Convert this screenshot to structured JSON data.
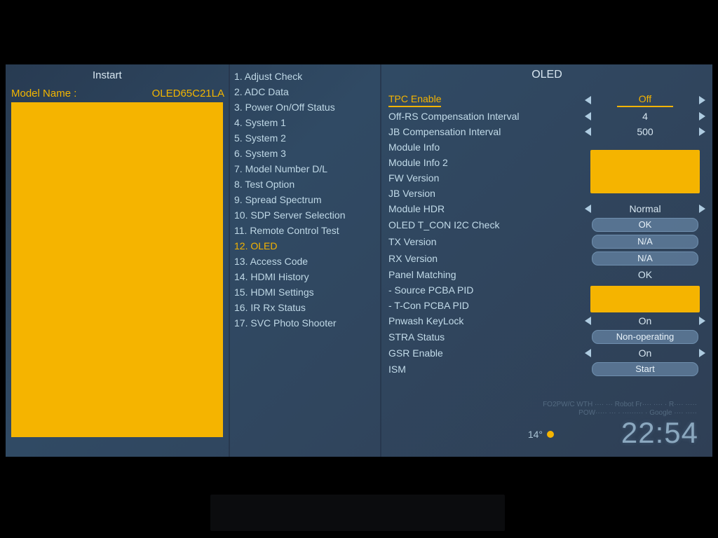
{
  "left": {
    "instart": "Instart",
    "model_label": "Model Name :",
    "model_value": "OLED65C21LA"
  },
  "menu": {
    "items": [
      "1. Adjust Check",
      "2. ADC Data",
      "3. Power On/Off Status",
      "4. System 1",
      "5. System 2",
      "6. System 3",
      "7. Model Number D/L",
      "8. Test Option",
      "9. Spread Spectrum",
      "10. SDP Server Selection",
      "11. Remote Control Test",
      "12. OLED",
      "13. Access Code",
      "14. HDMI History",
      "15. HDMI Settings",
      "16. IR Rx Status",
      "17. SVC Photo Shooter"
    ],
    "selected_index": 11
  },
  "right": {
    "title": "OLED",
    "rows": [
      {
        "label": "TPC Enable",
        "value": "Off",
        "arrows": true,
        "selected": true
      },
      {
        "label": "Off-RS Compensation Interval",
        "value": "4",
        "arrows": true
      },
      {
        "label": "JB Compensation Interval",
        "value": "500",
        "arrows": true
      },
      {
        "label": "Module Info"
      },
      {
        "label": "Module Info 2"
      },
      {
        "label": "FW Version"
      },
      {
        "label": "JB Version"
      },
      {
        "label": "Module HDR",
        "value": "Normal",
        "arrows": true
      },
      {
        "label": "OLED T_CON I2C Check",
        "value": "OK",
        "pill": true
      },
      {
        "label": "TX Version",
        "value": "N/A",
        "pill": true
      },
      {
        "label": "RX Version",
        "value": "N/A",
        "pill": true
      },
      {
        "label": "Panel Matching",
        "value": "OK",
        "plain": true
      },
      {
        "label": " - Source PCBA PID"
      },
      {
        "label": " - T-Con PCBA PID"
      },
      {
        "label": "Pnwash KeyLock",
        "value": "On",
        "arrows": true
      },
      {
        "label": "STRA Status",
        "value": "Non-operating",
        "pill": true
      },
      {
        "label": "GSR Enable",
        "value": "On",
        "arrows": true
      },
      {
        "label": "ISM",
        "value": "Start",
        "pill": true
      }
    ]
  },
  "status": {
    "temp": "14°",
    "clock": "22:54",
    "ticker1": "FO2PW/C WTH ···· ··· Robot Fr···· ···· · R···· ·····",
    "ticker2": "POW····· ··· · ········· · Google ···· ·····"
  }
}
